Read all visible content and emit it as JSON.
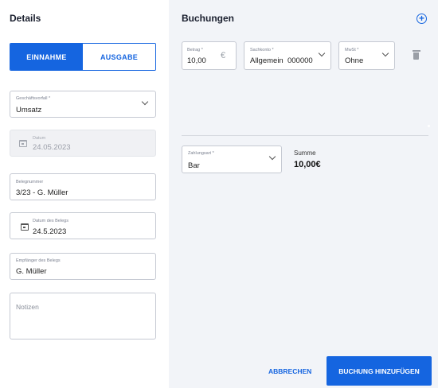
{
  "details": {
    "title": "Details",
    "toggle": {
      "income": "EINNAHME",
      "expense": "AUSGABE"
    },
    "transaction_type": {
      "label": "Geschäftsvorfall *",
      "value": "Umsatz"
    },
    "date": {
      "label": "Datum",
      "value": "24.05.2023"
    },
    "receipt_number": {
      "label": "Belegnummer",
      "value": "3/23 - G. Müller"
    },
    "receipt_date": {
      "label": "Datum des Belegs",
      "value": "24.5.2023"
    },
    "recipient": {
      "label": "Empfänger des Belegs",
      "value": "G. Müller"
    },
    "notes": {
      "placeholder": "Notizen"
    }
  },
  "bookings": {
    "title": "Buchungen",
    "amount": {
      "label": "Betrag *",
      "value": "10,00",
      "currency": "€"
    },
    "account": {
      "label": "Sachkonto *",
      "value": "Allgemein  000000"
    },
    "vat": {
      "label": "MwSt *",
      "value": "Ohne"
    },
    "payment": {
      "label": "Zahlungsart *",
      "value": "Bar"
    },
    "sum": {
      "label": "Summe",
      "value": "10,00€"
    }
  },
  "actions": {
    "cancel": "ABBRECHEN",
    "add": "BUCHUNG HINZUFÜGEN"
  },
  "colors": {
    "primary": "#1565e0",
    "panel": "#f2f4f8"
  }
}
